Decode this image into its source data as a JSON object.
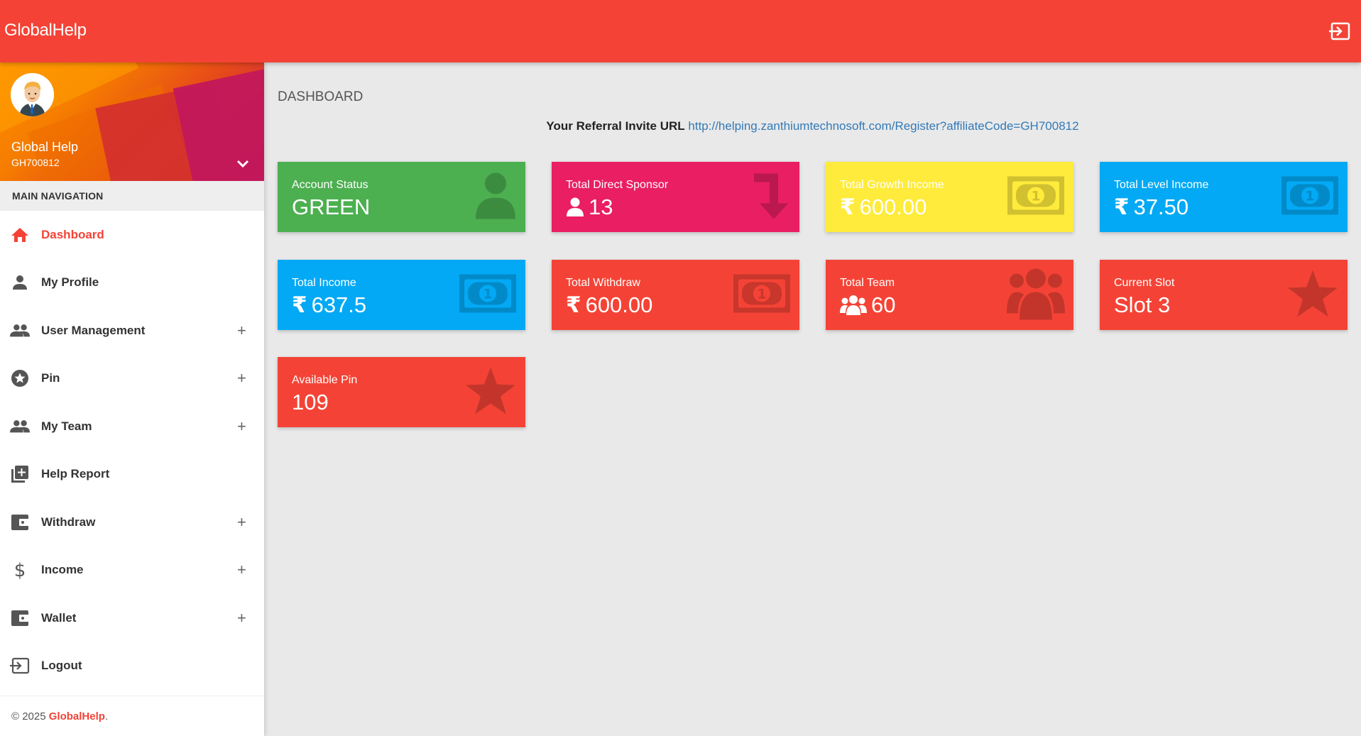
{
  "header": {
    "brand": "GlobalHelp"
  },
  "user": {
    "name": "Global Help",
    "code": "GH700812"
  },
  "nav": {
    "header": "MAIN NAVIGATION",
    "items": [
      {
        "label": "Dashboard",
        "icon": "home-icon",
        "expandable": false,
        "active": true
      },
      {
        "label": "My Profile",
        "icon": "person-icon",
        "expandable": false
      },
      {
        "label": "User Management",
        "icon": "people-icon",
        "expandable": true
      },
      {
        "label": "Pin",
        "icon": "star-circle-icon",
        "expandable": true
      },
      {
        "label": "My Team",
        "icon": "people-icon",
        "expandable": true
      },
      {
        "label": "Help Report",
        "icon": "library-add-icon",
        "expandable": false
      },
      {
        "label": "Withdraw",
        "icon": "wallet-icon",
        "expandable": true
      },
      {
        "label": "Income",
        "icon": "dollar-icon",
        "expandable": true
      },
      {
        "label": "Wallet",
        "icon": "wallet-icon",
        "expandable": true
      },
      {
        "label": "Logout",
        "icon": "logout-icon",
        "expandable": false
      }
    ],
    "plus": "+"
  },
  "footer": {
    "copyright": "© 2025 ",
    "brand": "GlobalHelp",
    "period": "."
  },
  "main": {
    "heading": "DASHBOARD",
    "referral_label": "Your Referral Invite URL",
    "referral_url": "http://helping.zanthiumtechnosoft.com/Register?affiliateCode=GH700812"
  },
  "cards": {
    "account_status": {
      "title": "Account Status",
      "value": "GREEN"
    },
    "direct_sponsor": {
      "title": "Total Direct Sponsor",
      "value": "13"
    },
    "growth_income": {
      "title": "Total Growth Income",
      "value": "600.00"
    },
    "level_income": {
      "title": "Total Level Income",
      "value": "37.50"
    },
    "total_income": {
      "title": "Total Income",
      "value": "637.5"
    },
    "total_withdraw": {
      "title": "Total Withdraw",
      "value": "600.00"
    },
    "total_team": {
      "title": "Total Team",
      "value": "60"
    },
    "current_slot": {
      "title": "Current Slot",
      "value": "Slot 3"
    },
    "available_pin": {
      "title": "Available Pin",
      "value": "109"
    },
    "currency_symbol": "₹"
  },
  "colors": {
    "primary": "#f44336",
    "green": "#4caf50",
    "pink": "#e91e63",
    "yellow": "#ffeb3b",
    "blue": "#03a9f4"
  }
}
